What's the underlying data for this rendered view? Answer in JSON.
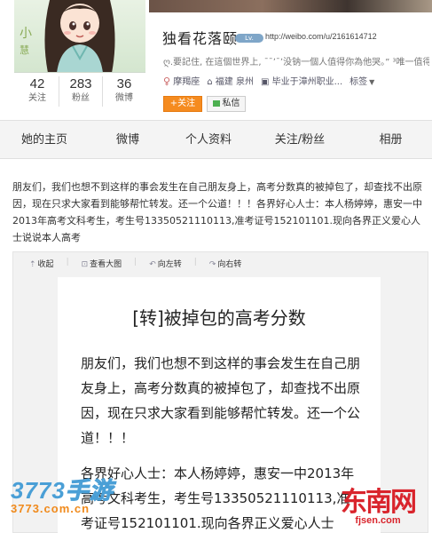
{
  "profile": {
    "username": "独看花落颐",
    "badge": "Lv.",
    "url": "http://weibo.com/u/2161614712",
    "bio": "ღ.要記住, 在這個世界上, ¯¯ʼ¯ʼ没钠一個人值得你為他哭。” ³唯一值得",
    "zodiac": "摩羯座",
    "location": "福建 泉州",
    "school": "毕业于漳州职业...",
    "tags_label": "标签",
    "follow_label": "+关注",
    "message_label": "私信",
    "stats": [
      {
        "num": "42",
        "label": "关注"
      },
      {
        "num": "283",
        "label": "粉丝"
      },
      {
        "num": "36",
        "label": "微博"
      }
    ]
  },
  "tabs": [
    "她的主页",
    "微博",
    "个人资料",
    "关注/粉丝",
    "相册"
  ],
  "post": {
    "text": "朋友们，我们也想不到这样的事会发生在自己朋友身上，高考分数真的被掉包了，却查找不出原因，现在只求大家看到能够帮忙转发。还一个公道！！！各界好心人士：本人杨婷婷，惠安一中2013年高考文科考生，考生号13350521110113,准考证号152101101.现向各界正义爱心人士说说本人高考"
  },
  "picture_toolbar": {
    "collapse": "收起",
    "view_large": "查看大图",
    "rotate_left": "向左转",
    "rotate_right": "向右转"
  },
  "doc": {
    "title": "[转]被掉包的高考分数",
    "para1": "朋友们，我们也想不到这样的事会发生在自己朋友身上，高考分数真的被掉包了，却查找不出原因，现在只求大家看到能够帮忙转发。还一个公道！！！",
    "para2": "各界好心人士：本人杨婷婷，惠安一中2013年高考文科考生，考生号13350521110113,准考证号152101101.现向各界正义爱心人士"
  },
  "watermarks": {
    "left_big_num": "3773",
    "left_big_cn": "手游",
    "left_small": "3773.com.cn",
    "right_big": "东南网",
    "right_small": "fjsen.com"
  }
}
